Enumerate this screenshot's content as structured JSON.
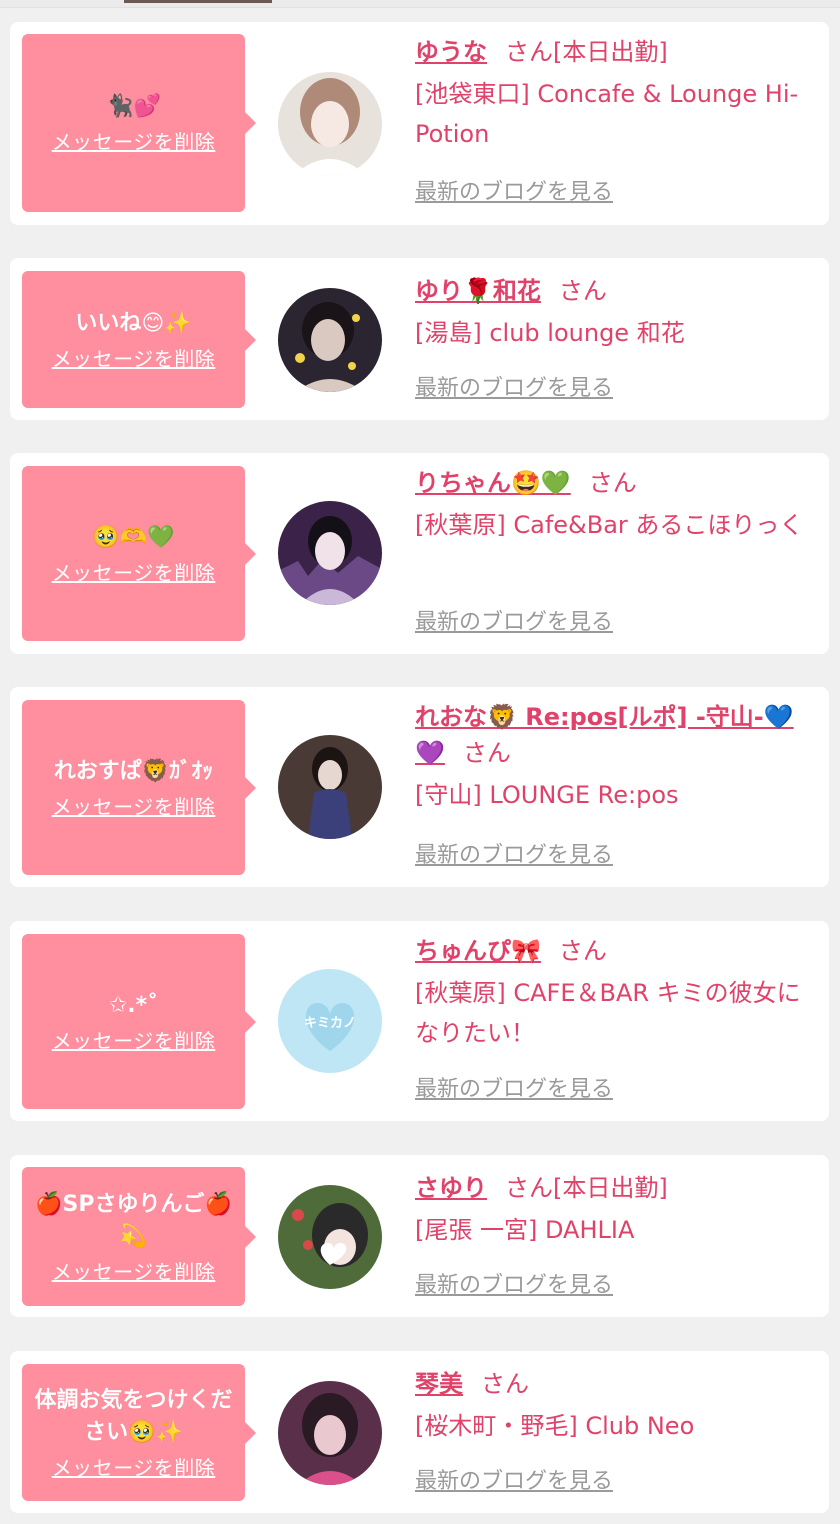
{
  "colors": {
    "accent_pink": "#e0426a",
    "bubble_pink": "#ff8f9f",
    "card_bg": "#ffffff",
    "page_bg": "#f0f0f0",
    "blog_link_gray": "#9a9a9a"
  },
  "common": {
    "delete_label": "メッセージを削除",
    "blog_label": "最新のブログを見る",
    "honorific": "さん"
  },
  "entries": [
    {
      "message": "🐈‍⬛💕",
      "name": "ゆうな",
      "status": "[本日出勤]",
      "shop": "[池袋東口] Concafe & Lounge Hi-Potion"
    },
    {
      "message": "いいね😊✨",
      "name": "ゆり🌹和花",
      "status": "",
      "shop": "[湯島] club lounge 和花"
    },
    {
      "message": "🥹🫶💚",
      "name": "りちゃん🤩💚",
      "status": "",
      "shop": "[秋葉原] Cafe&Bar あるこほりっく"
    },
    {
      "message": "れおすぱ🦁ｶﾞｵｯ",
      "name": "れおな🦁 Re:pos[ルポ] -守山-💙💜",
      "status": "",
      "shop": "[守山] LOUNGE Re:pos"
    },
    {
      "message": "✩.*˚",
      "name": "ちゅんぴ🎀",
      "status": "",
      "shop": "[秋葉原] CAFE＆BAR キミの彼女になりたい！"
    },
    {
      "message": "🍎SPさゆりんご🍎💫",
      "name": "さゆり",
      "status": "[本日出勤]",
      "shop": "[尾張 一宮] DAHLIA"
    },
    {
      "message": "体調お気をつけください🥹✨",
      "name": "琴美",
      "status": "",
      "shop": "[桜木町・野毛] Club Neo"
    }
  ],
  "avatars": [
    {
      "icon": "avatar-photo",
      "palette": [
        "#e8d9d0",
        "#b08a78",
        "#f6e8e2"
      ]
    },
    {
      "icon": "avatar-photo",
      "palette": [
        "#2a2530",
        "#d9c9c0",
        "#f2d34a"
      ]
    },
    {
      "icon": "avatar-photo",
      "palette": [
        "#3a2248",
        "#c9b8d8",
        "#8a64b0"
      ]
    },
    {
      "icon": "avatar-photo",
      "palette": [
        "#4a3a36",
        "#e6d8d0",
        "#3b3f7a"
      ]
    },
    {
      "icon": "avatar-logo",
      "palette": [
        "#bfe6f5",
        "#ffffff",
        "#9fd6ec"
      ],
      "text": "キミカノ"
    },
    {
      "icon": "avatar-photo",
      "palette": [
        "#4f6b3a",
        "#2a2a2a",
        "#d84a4a"
      ]
    },
    {
      "icon": "avatar-photo",
      "palette": [
        "#5a2f4a",
        "#e9c8cf",
        "#d9508a"
      ]
    }
  ]
}
